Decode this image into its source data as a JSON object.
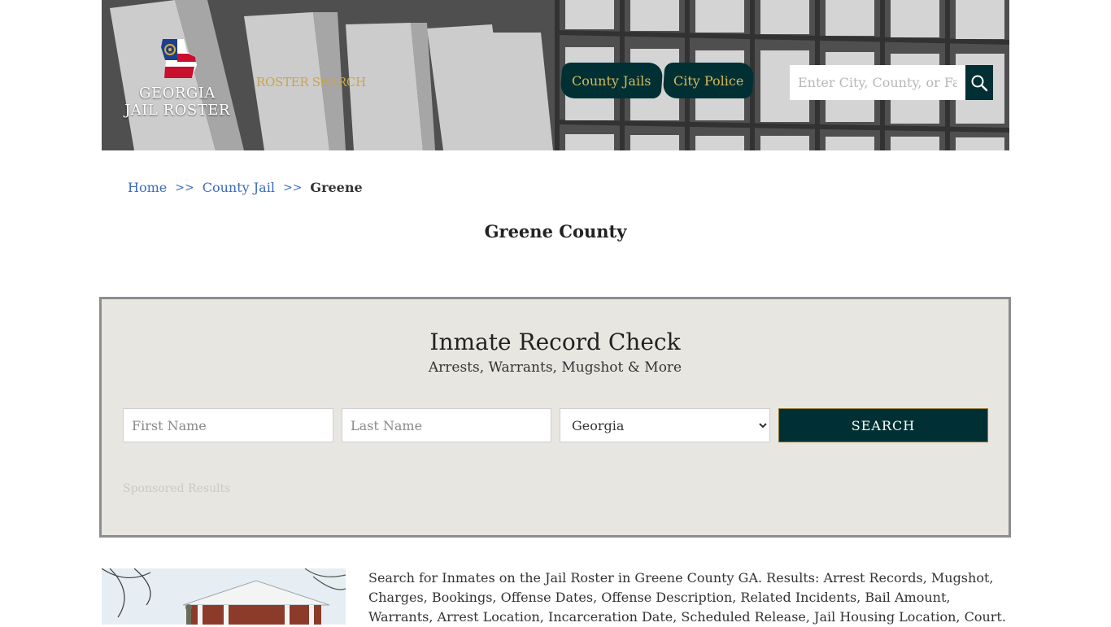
{
  "header": {
    "logo_line1": "GEORGIA",
    "logo_line2": "JAIL ROSTER",
    "roster_search_label": "ROSTER SEARCH",
    "nav": [
      {
        "label": "County Jails"
      },
      {
        "label": "City Police"
      }
    ],
    "search_placeholder": "Enter City, County, or Facility",
    "accent_color": "#003034",
    "gold_color": "#d8b85a"
  },
  "breadcrumb": {
    "items": [
      "Home",
      "County Jail"
    ],
    "separator": ">>",
    "current": "Greene"
  },
  "page_title": "Greene County",
  "record_check": {
    "title": "Inmate Record Check",
    "subtitle": "Arrests, Warrants, Mugshot & More",
    "first_name_placeholder": "First Name",
    "last_name_placeholder": "Last Name",
    "state_selected": "Georgia",
    "search_label": "SEARCH",
    "sponsored_label": "Sponsored Results"
  },
  "description": "Search for Inmates on the Jail Roster in Greene County GA. Results: Arrest Records, Mugshot, Charges, Bookings, Offense Dates, Offense Description, Related Incidents, Bail Amount, Warrants, Arrest Location, Incarceration Date, Scheduled Release, Jail Housing Location, Court."
}
